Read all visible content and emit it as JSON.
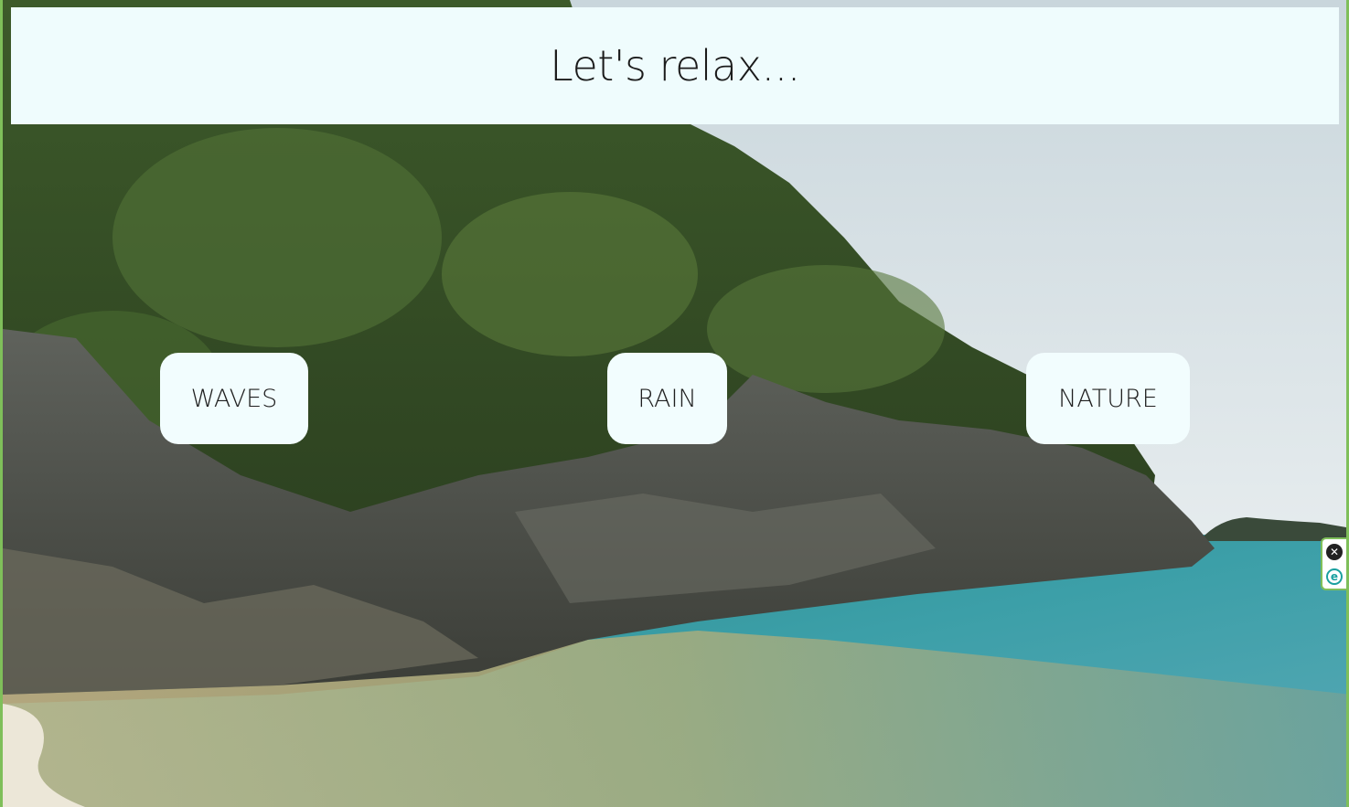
{
  "header": {
    "title": "Let's relax..."
  },
  "buttons": {
    "waves": "WAVES",
    "rain": "RAIN",
    "nature": "NATURE"
  },
  "extension_widget": {
    "close_icon": "close-icon",
    "extension_icon": "e-icon",
    "close_glyph": "✕",
    "extension_glyph": "e"
  },
  "colors": {
    "header_bg": "#effcfd",
    "button_bg": "#f2fdfe",
    "frame_border": "#7fbf5a"
  }
}
